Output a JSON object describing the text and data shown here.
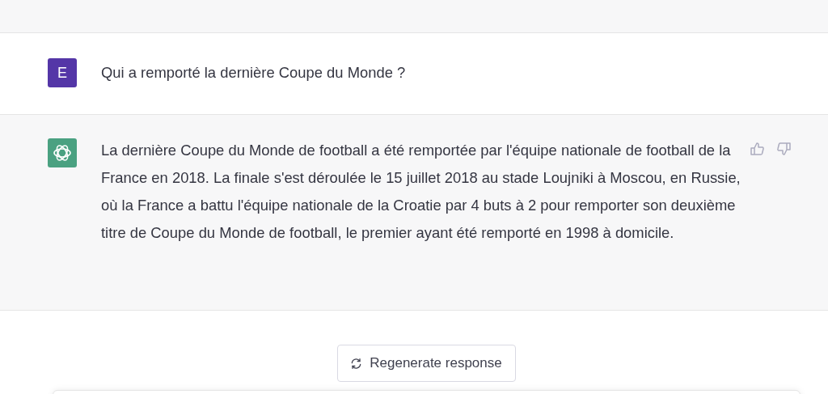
{
  "messages": [
    {
      "kind": "user",
      "avatar": "E",
      "text": "Qui a remporté la dernière Coupe du Monde ?"
    },
    {
      "kind": "assistant",
      "text": "La dernière Coupe du Monde de football a été remportée par l'équipe nationale de football de la France en 2018. La finale s'est déroulée le 15 juillet 2018 au stade Loujniki à Moscou, en Russie, où la France a battu l'équipe nationale de la Croatie par 4 buts à 2 pour remporter son deuxième titre de Coupe du Monde de football, le premier ayant été remporté en 1998 à domicile."
    }
  ],
  "regenerate_button": "Regenerate response"
}
